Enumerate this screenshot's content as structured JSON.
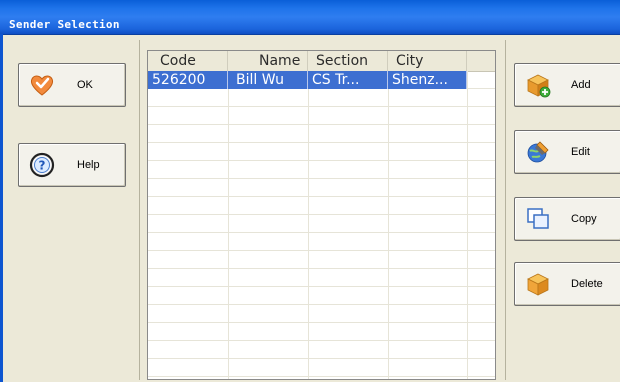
{
  "window": {
    "title": "Sender Selection"
  },
  "left_buttons": {
    "ok_label": "OK",
    "help_label": "Help"
  },
  "right_buttons": {
    "add_label": "Add",
    "edit_label": "Edit",
    "copy_label": "Copy",
    "delete_label": "Delete"
  },
  "table": {
    "columns": [
      "Code",
      "Name",
      "Section",
      "City"
    ],
    "rows": [
      {
        "code": "526200",
        "name": "Bill Wu",
        "section": "CS Tr...",
        "city": "Shenz...",
        "selected": true
      }
    ]
  },
  "colors": {
    "titlebar": "#1f74ea",
    "selection": "#3d6fd1",
    "background": "#ece9d8"
  },
  "icons": {
    "ok": "heart-check-icon",
    "help": "help-question-icon",
    "add": "box-add-icon",
    "edit": "globe-pencil-icon",
    "copy": "copy-windows-icon",
    "delete": "box-delete-icon"
  }
}
